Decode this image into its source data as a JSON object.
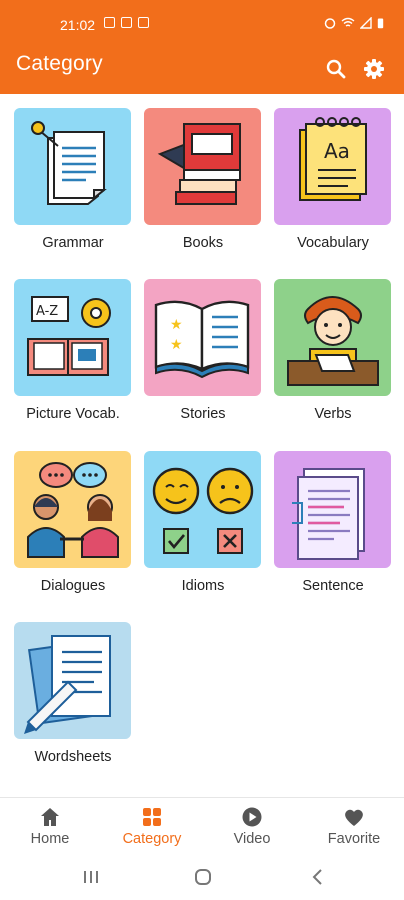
{
  "status_bar": {
    "time": "21:02"
  },
  "app_bar": {
    "title": "Category"
  },
  "categories": [
    {
      "label": "Grammar",
      "bg": "#8fd9f5"
    },
    {
      "label": "Books",
      "bg": "#f48a7e"
    },
    {
      "label": "Vocabulary",
      "bg": "#d9a0ee"
    },
    {
      "label": "Picture Vocab.",
      "bg": "#8fd9f5"
    },
    {
      "label": "Stories",
      "bg": "#f3a4c3"
    },
    {
      "label": "Verbs",
      "bg": "#8ed18a"
    },
    {
      "label": "Dialogues",
      "bg": "#fdd57a"
    },
    {
      "label": "Idioms",
      "bg": "#8fd9f5"
    },
    {
      "label": "Sentence",
      "bg": "#d9a0ee"
    },
    {
      "label": "Wordsheets",
      "bg": "#b7dcef"
    }
  ],
  "bottom_nav": {
    "items": [
      {
        "label": "Home",
        "icon": "home-icon"
      },
      {
        "label": "Category",
        "icon": "grid-icon"
      },
      {
        "label": "Video",
        "icon": "play-circle-icon"
      },
      {
        "label": "Favorite",
        "icon": "heart-icon"
      }
    ]
  },
  "colors": {
    "accent": "#f26e1b",
    "text": "#222222",
    "nav_inactive": "#555555"
  }
}
